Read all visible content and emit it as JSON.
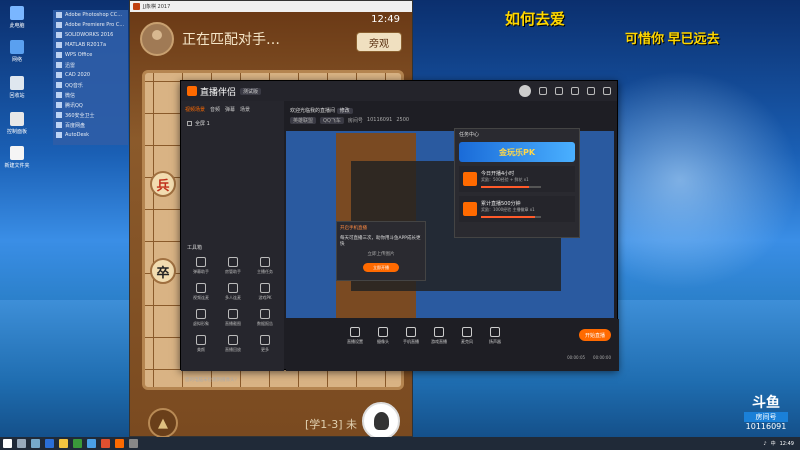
{
  "desktop": {
    "icons": [
      {
        "label": "此电脑"
      },
      {
        "label": "网络"
      },
      {
        "label": "回收站"
      },
      {
        "label": "控制面板"
      },
      {
        "label": "新建文件夹"
      }
    ],
    "recents": [
      "Adobe Photoshop CC...",
      "Adobe Premiere Pro C...",
      "SOLIDWORKS 2016",
      "MATLAB R2017a",
      "WPS Office",
      "迅雷",
      "CAD 2020",
      "QQ音乐",
      "微信",
      "腾讯QQ",
      "360安全卫士",
      "百度网盘",
      "AutoDesk"
    ],
    "caption_top": "如何去爱",
    "caption_right": "可惜你 早已远去"
  },
  "chess": {
    "window_title": "JJ象棋 2017",
    "match_status": "正在匹配对手…",
    "clock": "12:49",
    "watch_label": "旁观",
    "pieces": [
      {
        "text": "兵",
        "color": "#c0301a"
      },
      {
        "text": "卒",
        "color": "#222222"
      }
    ],
    "round_icon": "▲",
    "bottom_label": "[学1-3] 未"
  },
  "stream": {
    "app_name": "直播伴侣",
    "beta_tag": "测试版",
    "sidebar_tabs": [
      "视频场景",
      "音频",
      "弹幕",
      "场景"
    ],
    "scene_label": "全屏 1",
    "toolbox_title": "工具箱",
    "tools": [
      "弹幕助手",
      "房管助手",
      "主播任务",
      "视频连麦",
      "多人连麦",
      "游戏PK",
      "虚拟形象",
      "直播截图",
      "数据报告",
      "美颜",
      "直播回放",
      "更多"
    ],
    "camera_note": "您的电脑未检测到摄像头？",
    "header_title": "欢迎光临我的直播间",
    "header_tag": "修改",
    "header_sub": [
      "英雄联盟",
      "QQ飞车",
      "房间号",
      "10116091",
      "2500"
    ],
    "dialog_title": "开启手机直播",
    "dialog_body": "每天可直播三次，助你用斗鱼APP成长更快",
    "dialog_link": "立即上传图片",
    "dialog_button": "立即开播",
    "task_panel_title": "任务中心",
    "task_banner": "金玩乐PK",
    "tasks": [
      {
        "title": "今日开播4小时",
        "desc": "奖励：500经验 + 鲜花 x1",
        "progress": 0.8
      },
      {
        "title": "累计直播500分钟",
        "desc": "奖励：1000经验 主播徽章 x1",
        "progress": 0.9
      }
    ],
    "controls": [
      "直播设置",
      "摄像头",
      "手机直播",
      "游戏直播",
      "麦克风",
      "扬声器"
    ],
    "go_live": "开始直播",
    "stats": [
      "00:00:05",
      "00:00:00"
    ]
  },
  "watermark": {
    "logo": "斗鱼",
    "room_label": "房间号",
    "room_id": "10116091"
  },
  "taskbar": {
    "time": "12:49",
    "lang": "中"
  }
}
